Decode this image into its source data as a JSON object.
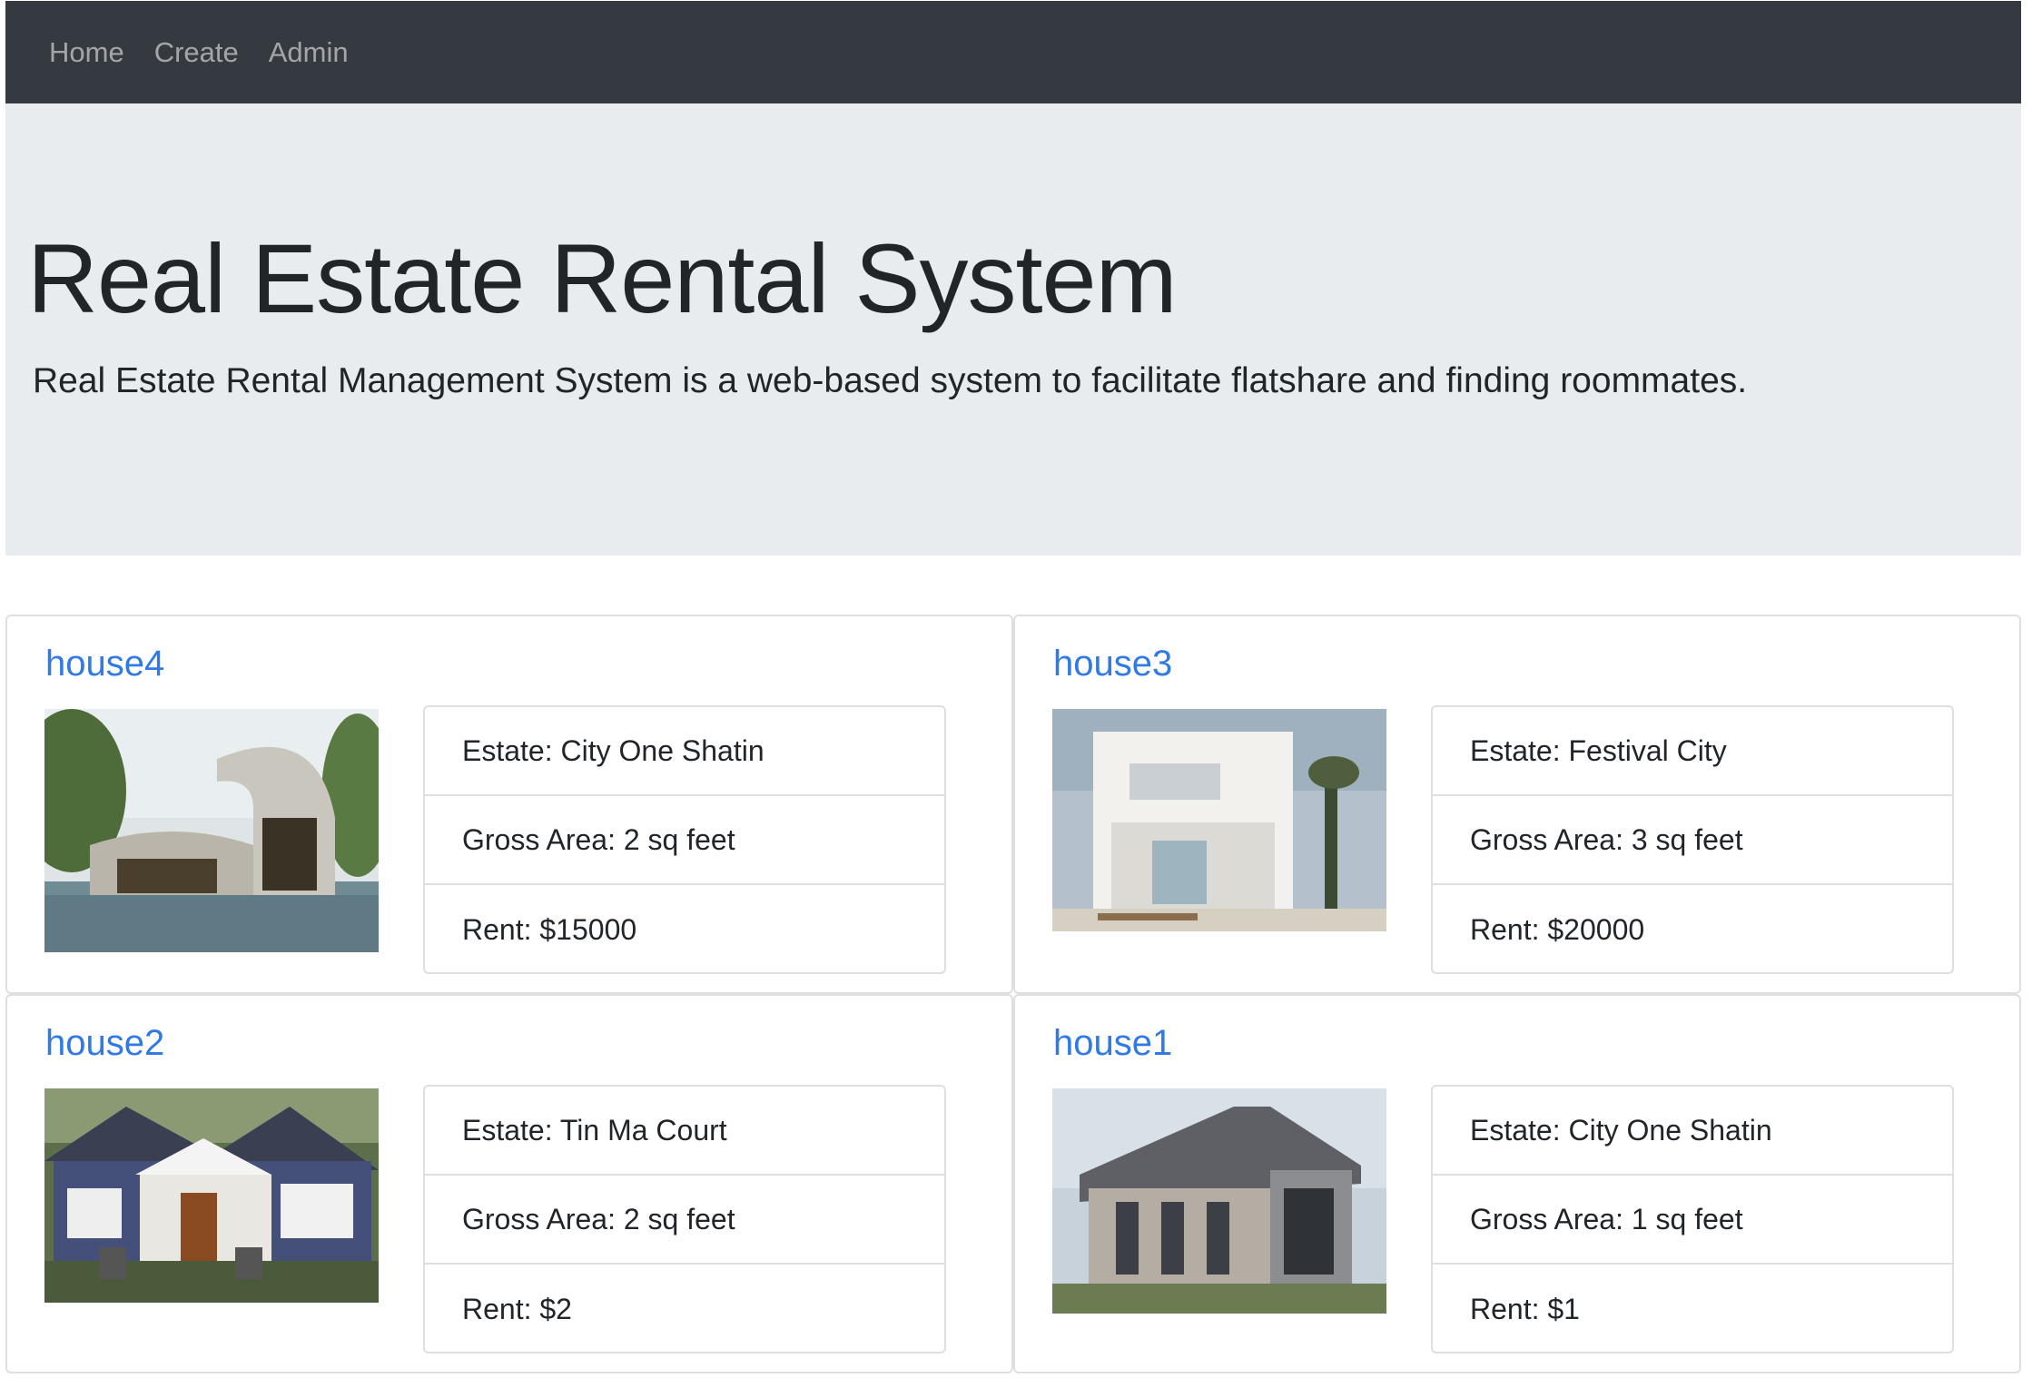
{
  "navbar": {
    "links": [
      "Home",
      "Create",
      "Admin"
    ]
  },
  "jumbotron": {
    "title": "Real Estate Rental System",
    "lead": "Real Estate Rental Management System is a web-based system to facilitate flatshare and finding roommates."
  },
  "listings": [
    {
      "name": "house4",
      "estate": "Estate: City One Shatin",
      "area": "Gross Area: 2 sq feet",
      "rent": "Rent: $15000"
    },
    {
      "name": "house3",
      "estate": "Estate: Festival City",
      "area": "Gross Area: 3 sq feet",
      "rent": "Rent: $20000"
    },
    {
      "name": "house2",
      "estate": "Estate: Tin Ma Court",
      "area": "Gross Area: 2 sq feet",
      "rent": "Rent: $2"
    },
    {
      "name": "house1",
      "estate": "Estate: City One Shatin",
      "area": "Gross Area: 1 sq feet",
      "rent": "Rent: $1"
    }
  ],
  "colors": {
    "navbar": "#343a40",
    "jumbotron": "#e9ecef",
    "link": "#2f7ae5",
    "border": "#dfdfdf"
  }
}
